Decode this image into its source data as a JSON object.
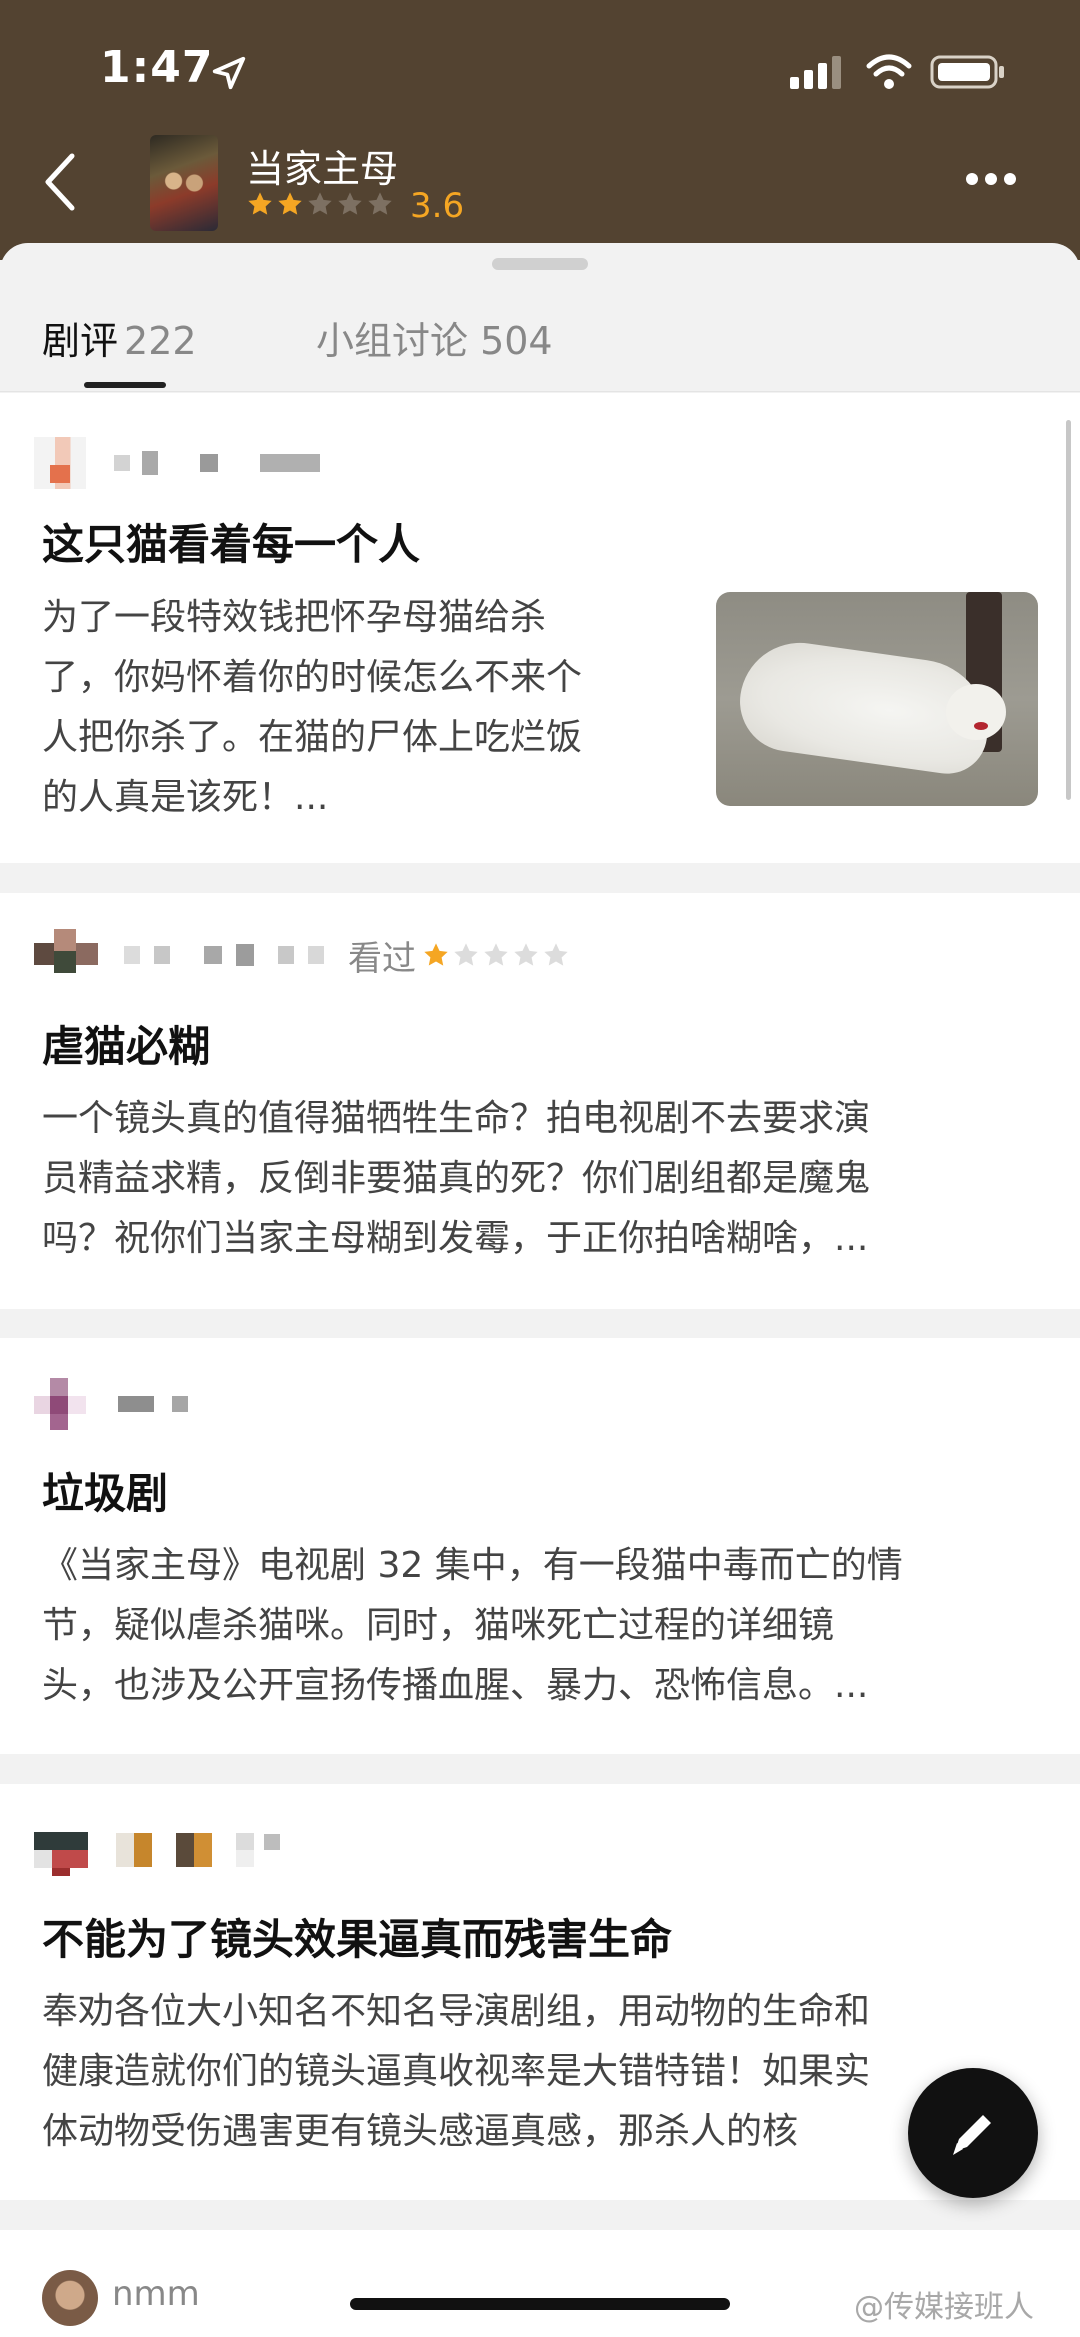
{
  "status_bar": {
    "time": "1:47"
  },
  "header": {
    "title": "当家主母",
    "rating": "3.6",
    "stars_filled": 2,
    "stars_total": 5
  },
  "tabs": [
    {
      "label": "剧评",
      "count": "222",
      "active": true
    },
    {
      "label": "小组讨论 504",
      "active": false
    }
  ],
  "reviews": [
    {
      "title": "这只猫看着每一个人",
      "body": [
        "为了一段特效钱把怀孕母猫给杀",
        "了，你妈怀着你的时候怎么不来个",
        "人把你杀了。在猫的尸体上吃烂饭",
        "的人真是该死！..."
      ],
      "has_thumbnail": true
    },
    {
      "watched_label": "看过",
      "rating_stars": 1,
      "title": "虐猫必糊",
      "body": [
        "一个镜头真的值得猫牺牲生命？拍电视剧不去要求演",
        "员精益求精，反倒非要猫真的死？你们剧组都是魔鬼",
        "吗？祝你们当家主母糊到发霉，于正你拍啥糊啥，..."
      ]
    },
    {
      "title": "垃圾剧",
      "body": [
        "《当家主母》电视剧 32 集中，有一段猫中毒而亡的情",
        "节，疑似虐杀猫咪。同时，猫咪死亡过程的详细镜",
        "头，也涉及公开宣扬传播血腥、暴力、恐怖信息。..."
      ]
    },
    {
      "title": "不能为了镜头效果逼真而残害生命",
      "body": [
        "奉劝各位大小知名不知名导演剧组，用动物的生命和",
        "健康造就你们的镜头逼真收视率是大错特错！如果实",
        "体动物受伤遇害更有镜头感逼真感，那杀人的核"
      ]
    }
  ],
  "bottom_user": {
    "name": "nmm"
  },
  "watermark": "@传媒接班人",
  "colors": {
    "header_bg": "#534331",
    "star": "#f5a623",
    "star_empty": "#cfcfcf"
  }
}
